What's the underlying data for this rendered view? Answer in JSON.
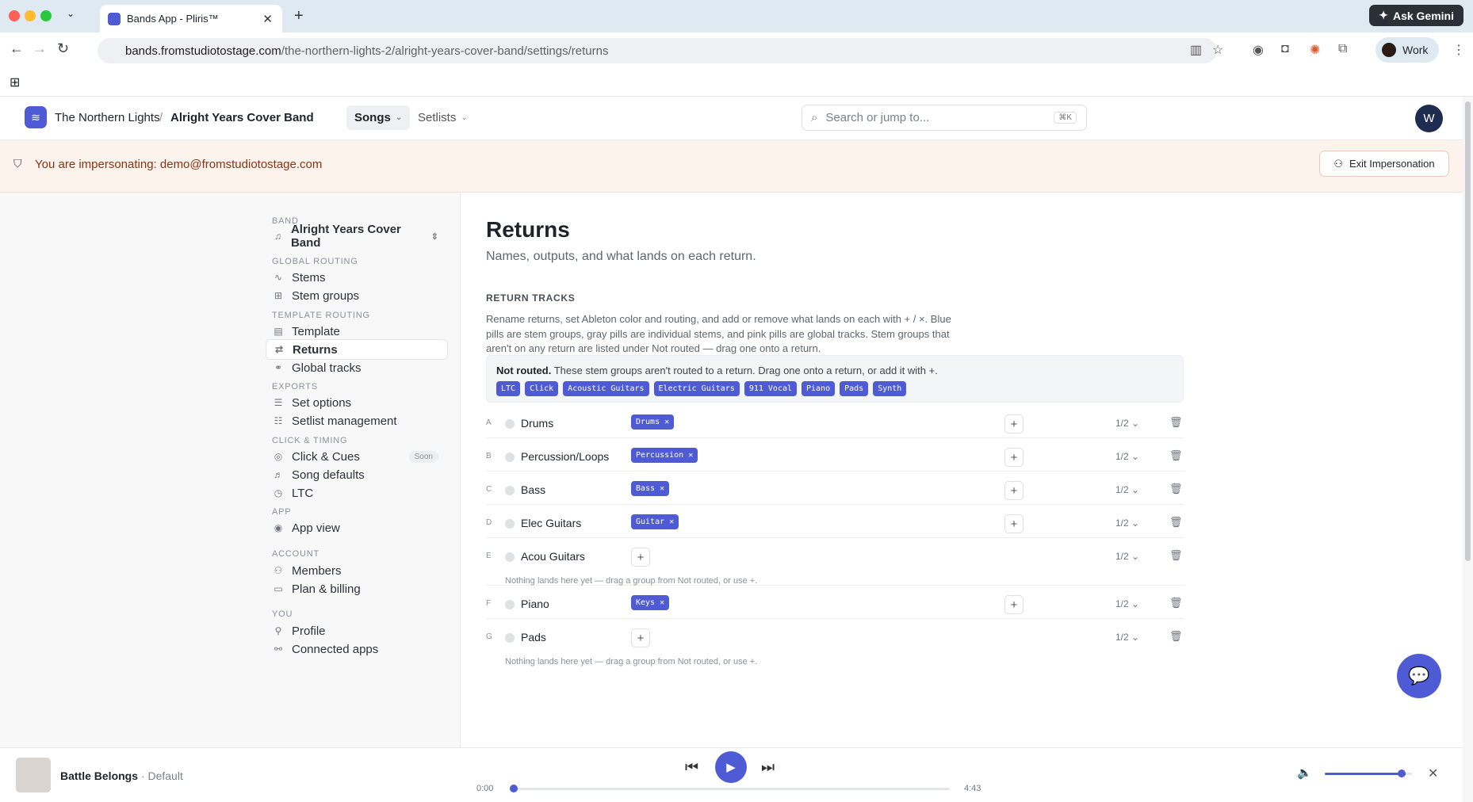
{
  "browser": {
    "tab_title": "Bands App - Pliris™",
    "url_host": "bands.fromstudiotostage.com",
    "url_path": "/the-northern-lights-2/alright-years-cover-band/settings/returns",
    "gemini_label": "Ask Gemini",
    "profile_label": "Work"
  },
  "header": {
    "org": "The Northern Lights",
    "band": "Alright Years Cover Band",
    "nav_songs": "Songs",
    "nav_setlists": "Setlists",
    "search_placeholder": "Search or jump to...",
    "search_kbd": "⌘K",
    "avatar_initial": "W"
  },
  "banner": {
    "text": "You are impersonating: demo@fromstudiotostage.com",
    "exit_label": "Exit Impersonation"
  },
  "sidebar": {
    "band_section": "BAND",
    "band_name": "Alright Years Cover Band",
    "sections": {
      "global_routing": "GLOBAL ROUTING",
      "template_routing": "TEMPLATE ROUTING",
      "exports": "EXPORTS",
      "click_timing": "CLICK & TIMING",
      "app": "APP",
      "account": "ACCOUNT",
      "you": "YOU"
    },
    "items": {
      "stems": "Stems",
      "stem_groups": "Stem groups",
      "template": "Template",
      "returns": "Returns",
      "global_tracks": "Global tracks",
      "set_options": "Set options",
      "setlist_management": "Setlist management",
      "click_cues": "Click & Cues",
      "soon_badge": "Soon",
      "song_defaults": "Song defaults",
      "ltc": "LTC",
      "app_view": "App view",
      "members": "Members",
      "plan_billing": "Plan & billing",
      "profile": "Profile",
      "connected_apps": "Connected apps"
    }
  },
  "main": {
    "title": "Returns",
    "subtitle": "Names, outputs, and what lands on each return.",
    "section_title": "RETURN TRACKS",
    "description": "Rename returns, set Ableton color and routing, and add or remove what lands on each with + / ×. Blue pills are stem groups, gray pills are individual stems, and pink pills are global tracks. Stem groups that aren't on any return are listed under Not routed — drag one onto a return.",
    "not_routed_bold": "Not routed.",
    "not_routed_text": "These stem groups aren't routed to a return. Drag one onto a return, or add it with +.",
    "not_routed_tags": [
      "LTC",
      "Click",
      "Acoustic Guitars",
      "Electric Guitars",
      "911 Vocal",
      "Piano",
      "Pads",
      "Synth"
    ],
    "empty_text": "Nothing lands here yet — drag a group from Not routed, or use +.",
    "returns": [
      {
        "letter": "A",
        "name": "Drums",
        "chip": "Drums",
        "ratio": "1/2"
      },
      {
        "letter": "B",
        "name": "Percussion/Loops",
        "chip": "Percussion",
        "ratio": "1/2"
      },
      {
        "letter": "C",
        "name": "Bass",
        "chip": "Bass",
        "ratio": "1/2"
      },
      {
        "letter": "D",
        "name": "Elec Guitars",
        "chip": "Guitar",
        "ratio": "1/2"
      },
      {
        "letter": "E",
        "name": "Acou Guitars",
        "chip": "",
        "ratio": "1/2"
      },
      {
        "letter": "F",
        "name": "Piano",
        "chip": "Keys",
        "ratio": "1/2"
      },
      {
        "letter": "G",
        "name": "Pads",
        "chip": "",
        "ratio": "1/2"
      }
    ]
  },
  "player": {
    "song": "Battle Belongs",
    "version": "Default",
    "time_current": "0:00",
    "time_total": "4:43",
    "progress": 0.0,
    "volume": 0.85
  },
  "colors": {
    "accent": "#4f5bd5",
    "banner_bg": "#fcf3ec",
    "banner_text": "#8a3212"
  }
}
